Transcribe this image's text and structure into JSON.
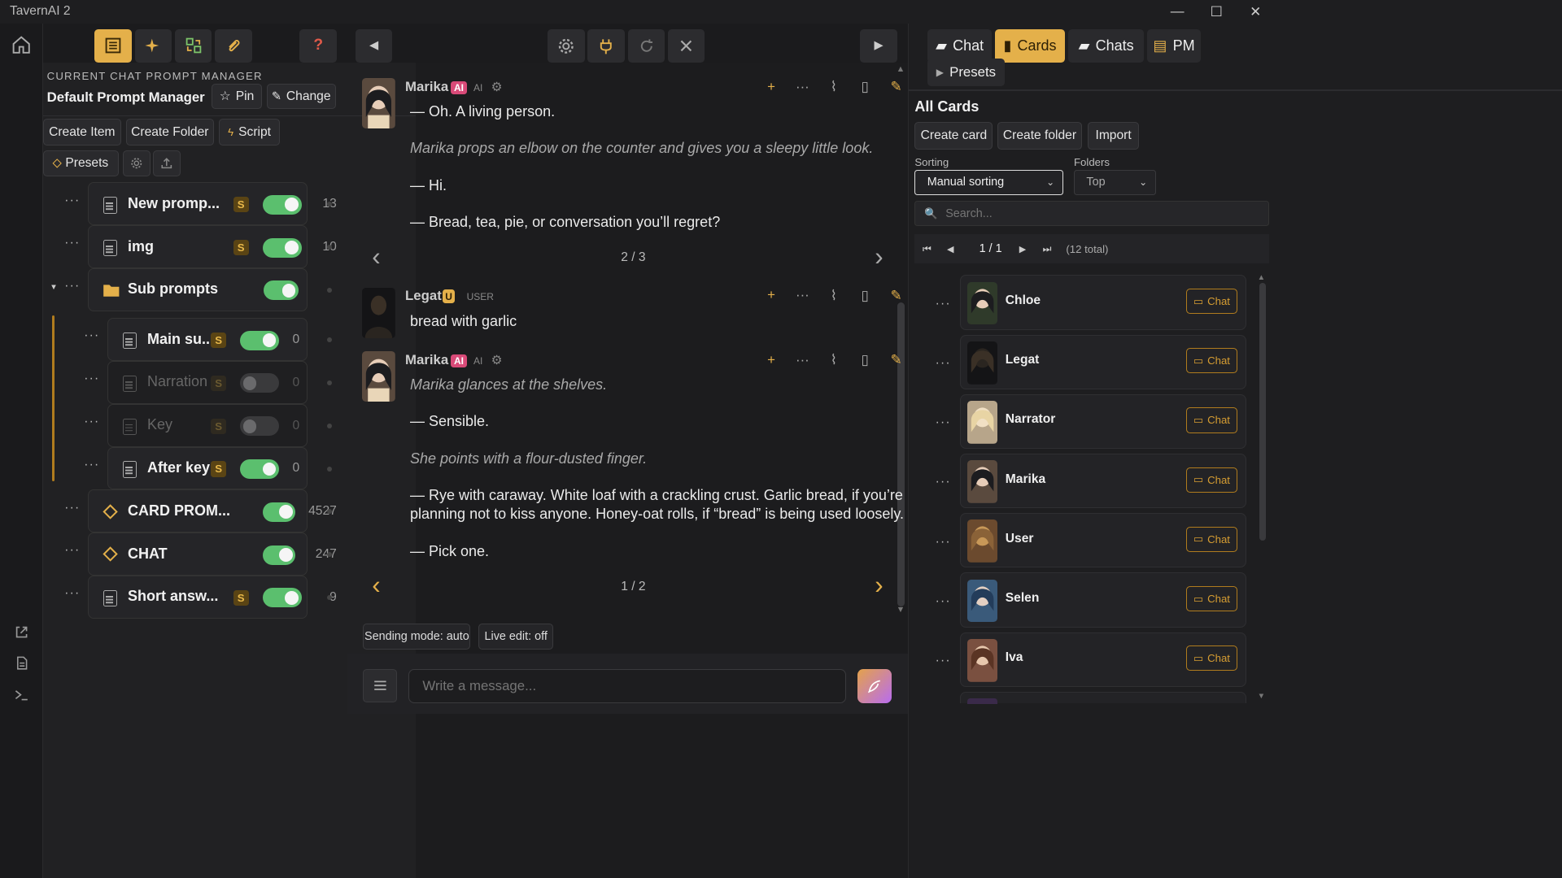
{
  "app": {
    "title": "TavernAI 2"
  },
  "window_controls": {
    "minimize": "—",
    "maximize": "☐",
    "close": "✕"
  },
  "toolbar": {
    "help": "?",
    "prev": "◀",
    "next": "▶"
  },
  "prompt_manager": {
    "section_label": "CURRENT CHAT PROMPT MANAGER",
    "name": "Default Prompt Manager",
    "pin_label": "Pin",
    "change_label": "Change",
    "create_item": "Create Item",
    "create_folder": "Create Folder",
    "script": "Script",
    "presets": "Presets",
    "items": [
      {
        "name": "New promp...",
        "s": "S",
        "count": "13",
        "on": true
      },
      {
        "name": "img",
        "s": "S",
        "count": "10",
        "on": true
      },
      {
        "name": "Sub prompts",
        "on": true
      },
      {
        "name": "Main su...",
        "s": "S",
        "count": "0",
        "on": true
      },
      {
        "name": "Narration",
        "s": "S",
        "count": "0",
        "on": false
      },
      {
        "name": "Key",
        "s": "S",
        "count": "0",
        "on": false
      },
      {
        "name": "After key",
        "s": "S",
        "count": "0",
        "on": true
      },
      {
        "name": "CARD PROM...",
        "count": "4527",
        "on": true
      },
      {
        "name": "CHAT",
        "count": "247",
        "on": true
      },
      {
        "name": "Short answ...",
        "s": "S",
        "count": "9",
        "on": true
      }
    ],
    "dots": "···"
  },
  "chat": {
    "messages": [
      {
        "name": "Marika",
        "badge": "AI",
        "role": "AI",
        "lines": [
          "— Oh. A living person.",
          "Marika props an elbow on the counter and gives you a sleepy little look.",
          "— Hi.",
          "— Bread, tea, pie, or conversation you’ll regret?"
        ],
        "pager": "2 / 3"
      },
      {
        "name": "Legat",
        "badge": "U",
        "role": "USER",
        "lines": [
          "bread with garlic"
        ]
      },
      {
        "name": "Marika",
        "badge": "AI",
        "role": "AI",
        "lines": [
          "Marika glances at the shelves.",
          "— Sensible.",
          "She points with a flour-dusted finger.",
          "— Rye with caraway. White loaf with a crackling crust. Garlic bread, if you’re brave and",
          "planning not to kiss anyone. Honey-oat rolls, if “bread” is being used loosely.",
          "— Pick one."
        ],
        "pager": "1 / 2"
      }
    ],
    "sending_mode": "Sending mode: auto",
    "live_edit": "Live edit: off",
    "input_placeholder": "Write a message..."
  },
  "cards_panel": {
    "tabs": [
      "Chat",
      "Cards",
      "Chats",
      "PM",
      "Presets"
    ],
    "title": "All Cards",
    "create_card": "Create card",
    "create_folder": "Create folder",
    "import": "Import",
    "sorting_label": "Sorting",
    "sorting_value": "Manual sorting",
    "folders_label": "Folders",
    "folders_value": "Top",
    "search_placeholder": "Search...",
    "page": "1 / 1",
    "total": "(12 total)",
    "chat_label": "Chat",
    "cards": [
      "Chloe",
      "Legat",
      "Narrator",
      "Marika",
      "User",
      "Selen",
      "Iva"
    ]
  }
}
